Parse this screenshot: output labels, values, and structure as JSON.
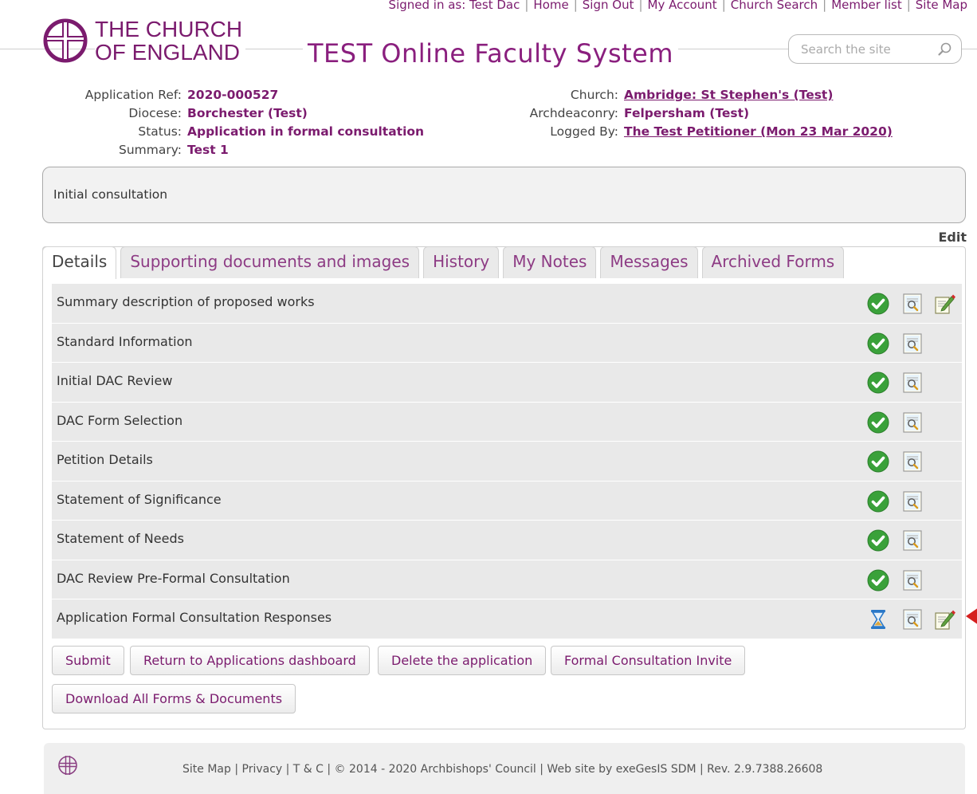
{
  "topnav": {
    "items": [
      "Signed in as: Test Dac",
      "Home",
      "Sign Out",
      "My Account",
      "Church Search",
      "Member list",
      "Site Map"
    ]
  },
  "brand": {
    "line1": "THE CHURCH",
    "line2": "OF ENGLAND",
    "logo_icon": "cross-circle-logo-icon",
    "color": "#7b1b6e"
  },
  "system_title": "TEST Online Faculty System",
  "search": {
    "placeholder": "Search the site",
    "icon": "search-icon"
  },
  "application": {
    "left": [
      {
        "label": "Application Ref:",
        "value": "2020-000527"
      },
      {
        "label": "Diocese:",
        "value": "Borchester (Test)"
      },
      {
        "label": "Status:",
        "value": "Application in formal consultation"
      },
      {
        "label": "Summary:",
        "value": "Test 1"
      }
    ],
    "right": [
      {
        "label": "Church:",
        "value": "Ambridge: St Stephen's (Test)",
        "link": true
      },
      {
        "label": "Archdeaconry:",
        "value": "Felpersham (Test)",
        "link": false
      },
      {
        "label": "Logged By:",
        "value": "The Test Petitioner (Mon 23 Mar 2020)",
        "link": true
      }
    ]
  },
  "consultation_note": "Initial consultation",
  "edit_label": "Edit",
  "tabs": [
    {
      "label": "Details",
      "active": true
    },
    {
      "label": "Supporting documents and images",
      "active": false
    },
    {
      "label": "History",
      "active": false
    },
    {
      "label": "My Notes",
      "active": false
    },
    {
      "label": "Messages",
      "active": false
    },
    {
      "label": "Archived Forms",
      "active": false
    }
  ],
  "forms": [
    {
      "label": "Summary description of proposed works",
      "status": "complete",
      "editable": true
    },
    {
      "label": "Standard Information",
      "status": "complete",
      "editable": false
    },
    {
      "label": "Initial DAC Review",
      "status": "complete",
      "editable": false
    },
    {
      "label": "DAC Form Selection",
      "status": "complete",
      "editable": false
    },
    {
      "label": "Petition Details",
      "status": "complete",
      "editable": false
    },
    {
      "label": "Statement of Significance",
      "status": "complete",
      "editable": false
    },
    {
      "label": "Statement of Needs",
      "status": "complete",
      "editable": false
    },
    {
      "label": "DAC Review Pre-Formal Consultation",
      "status": "complete",
      "editable": false
    },
    {
      "label": "Application Formal Consultation Responses",
      "status": "pending",
      "editable": true
    }
  ],
  "buttons": {
    "submit": "Submit",
    "return": "Return to Applications dashboard",
    "delete": "Delete the application",
    "invite": "Formal Consultation Invite",
    "download": "Download All Forms & Documents"
  },
  "footer": {
    "text": "Site Map | Privacy | T & C | © 2014 - 2020 Archbishops' Council | Web site by exeGesIS SDM | Rev. 2.9.7388.26608"
  },
  "colors": {
    "accent": "#7b1b6e",
    "complete": "#3aa13a",
    "pending": "#2a78c8",
    "arrow": "#d61f1f"
  }
}
